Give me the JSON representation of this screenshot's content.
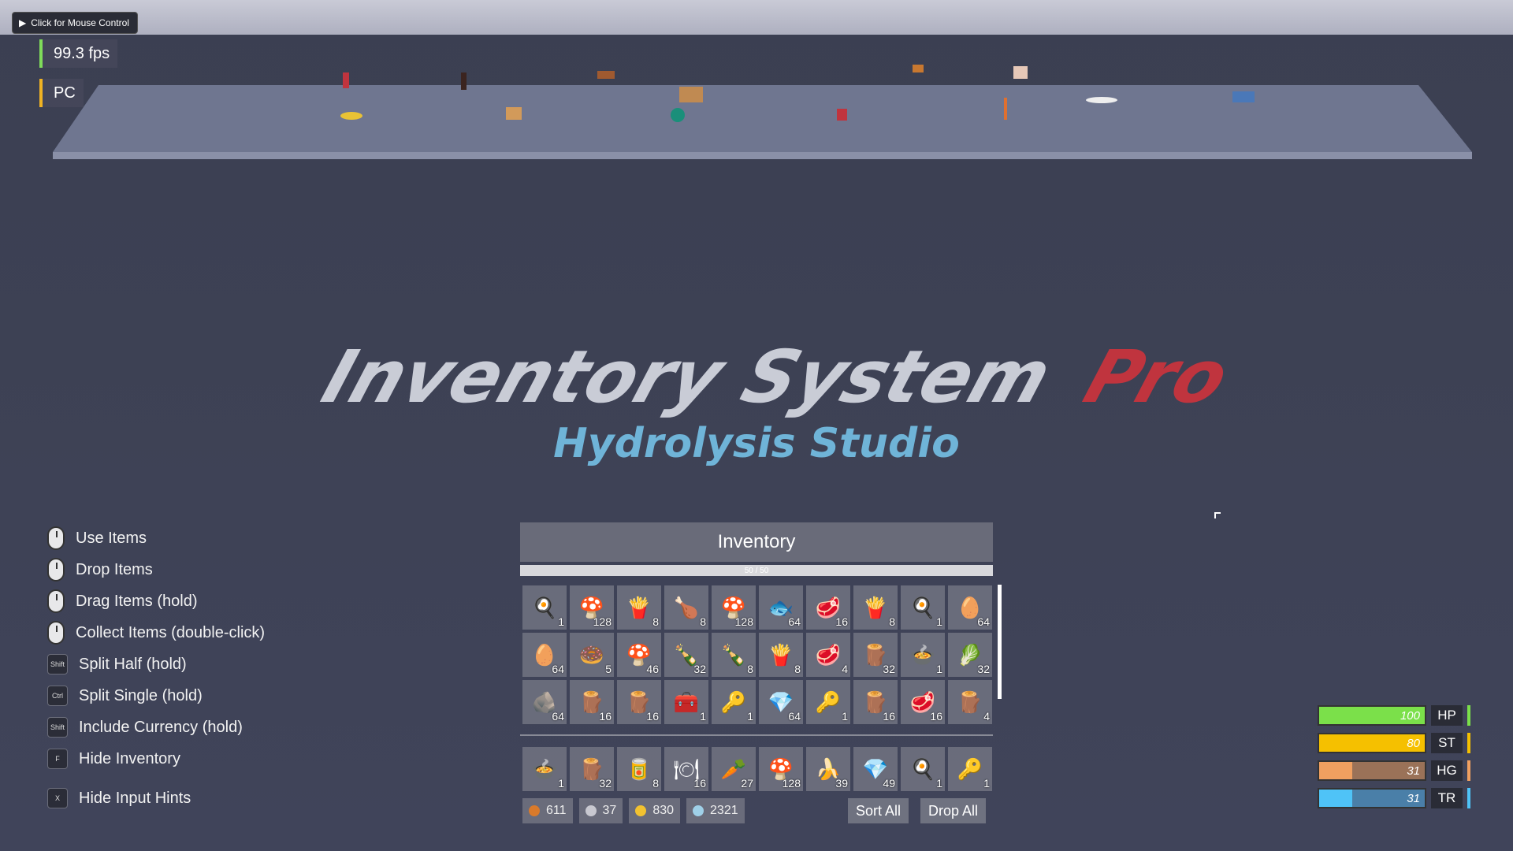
{
  "mouse_control": {
    "label": "Click for Mouse Control"
  },
  "fps": {
    "label": "99.3 fps",
    "color": "#7fdc5a"
  },
  "platform_label": {
    "label": "PC",
    "color": "#f0b323"
  },
  "title": {
    "main": "Inventory System",
    "accent": "Pro",
    "subtitle": "Hydrolysis Studio"
  },
  "colors": {
    "title_main": "#c9ccd6",
    "title_accent": "#c0343e",
    "subtitle": "#6fb4d8"
  },
  "hints": [
    {
      "key": "mouse-left",
      "label": "Use Items"
    },
    {
      "key": "mouse-right",
      "label": "Drop Items"
    },
    {
      "key": "mouse-left",
      "label": "Drag Items (hold)"
    },
    {
      "key": "mouse-left",
      "label": "Collect Items (double-click)"
    },
    {
      "key": "Shift",
      "label": "Split Half (hold)"
    },
    {
      "key": "Ctrl",
      "label": "Split Single (hold)"
    },
    {
      "key": "Shift",
      "label": "Include Currency (hold)"
    },
    {
      "key": "F",
      "label": "Hide Inventory"
    },
    {
      "key": "X",
      "label": "Hide Input Hints"
    }
  ],
  "inventory": {
    "title": "Inventory",
    "capacity": "50 / 50",
    "slots": [
      {
        "icon": "pan-icon",
        "glyph": "🍳",
        "count": "1"
      },
      {
        "icon": "mushroom-icon",
        "glyph": "🍄",
        "count": "128"
      },
      {
        "icon": "fries-icon",
        "glyph": "🍟",
        "count": "8"
      },
      {
        "icon": "meat-leg-icon",
        "glyph": "🍗",
        "count": "8"
      },
      {
        "icon": "mushroom-icon",
        "glyph": "🍄",
        "count": "128"
      },
      {
        "icon": "fish-icon",
        "glyph": "🐟",
        "count": "64"
      },
      {
        "icon": "steak-icon",
        "glyph": "🥩",
        "count": "16"
      },
      {
        "icon": "fries-icon",
        "glyph": "🍟",
        "count": "8"
      },
      {
        "icon": "pan-icon",
        "glyph": "🍳",
        "count": "1"
      },
      {
        "icon": "egg-icon",
        "glyph": "🥚",
        "count": "64"
      },
      {
        "icon": "egg-icon",
        "glyph": "🥚",
        "count": "64"
      },
      {
        "icon": "donut-icon",
        "glyph": "🍩",
        "count": "5"
      },
      {
        "icon": "mushroom-icon",
        "glyph": "🍄",
        "count": "46"
      },
      {
        "icon": "bottle-icon",
        "glyph": "🍾",
        "count": "32"
      },
      {
        "icon": "bottle-icon",
        "glyph": "🍾",
        "count": "8"
      },
      {
        "icon": "fries-icon",
        "glyph": "🍟",
        "count": "8"
      },
      {
        "icon": "steak-icon",
        "glyph": "🥩",
        "count": "4"
      },
      {
        "icon": "logs-icon",
        "glyph": "🪵",
        "count": "32"
      },
      {
        "icon": "pot-icon",
        "glyph": "🍲",
        "count": "1"
      },
      {
        "icon": "cabbage-icon",
        "glyph": "🥬",
        "count": "32"
      },
      {
        "icon": "stone-icon",
        "glyph": "🪨",
        "count": "64"
      },
      {
        "icon": "plank-icon",
        "glyph": "🪵",
        "count": "16"
      },
      {
        "icon": "plank-icon",
        "glyph": "🪵",
        "count": "16"
      },
      {
        "icon": "chest-icon",
        "glyph": "🧰",
        "count": "1"
      },
      {
        "icon": "key-icon",
        "glyph": "🔑",
        "count": "1"
      },
      {
        "icon": "ore-icon",
        "glyph": "💎",
        "count": "64"
      },
      {
        "icon": "key-icon",
        "glyph": "🔑",
        "count": "1"
      },
      {
        "icon": "plank-icon",
        "glyph": "🪵",
        "count": "16"
      },
      {
        "icon": "steak-icon",
        "glyph": "🥩",
        "count": "16"
      },
      {
        "icon": "plank-icon",
        "glyph": "🪵",
        "count": "4"
      }
    ],
    "hotbar": [
      {
        "icon": "pot-icon",
        "glyph": "🍲",
        "count": "1"
      },
      {
        "icon": "logs-icon",
        "glyph": "🪵",
        "count": "32"
      },
      {
        "icon": "can-icon",
        "glyph": "🥫",
        "count": "8"
      },
      {
        "icon": "plate-icon",
        "glyph": "🍽",
        "count": "16"
      },
      {
        "icon": "carrot-icon",
        "glyph": "🥕",
        "count": "27"
      },
      {
        "icon": "mushroom-icon",
        "glyph": "🍄",
        "count": "128"
      },
      {
        "icon": "banana-icon",
        "glyph": "🍌",
        "count": "39"
      },
      {
        "icon": "ore-icon",
        "glyph": "💎",
        "count": "49"
      },
      {
        "icon": "pan-icon",
        "glyph": "🍳",
        "count": "1"
      },
      {
        "icon": "key-icon",
        "glyph": "🔑",
        "count": "1"
      }
    ],
    "currency": [
      {
        "icon": "copper-coin-icon",
        "color": "#d97a2b",
        "value": "611"
      },
      {
        "icon": "silver-coin-icon",
        "color": "#c8c8d0",
        "value": "37"
      },
      {
        "icon": "gold-coin-icon",
        "color": "#f2c230",
        "value": "830"
      },
      {
        "icon": "gem-icon",
        "color": "#9fd0e8",
        "value": "2321"
      }
    ],
    "sort_label": "Sort All",
    "drop_label": "Drop All"
  },
  "vitals": [
    {
      "label": "HP",
      "value": "100",
      "level": 1.0,
      "color": "#7be04a",
      "track": "#7be04a"
    },
    {
      "label": "ST",
      "value": "80",
      "level": 1.0,
      "color": "#f5c000",
      "track": "#f5c000"
    },
    {
      "label": "HG",
      "value": "31",
      "level": 0.31,
      "color": "#f0a060",
      "track": "#9a7258"
    },
    {
      "label": "TR",
      "value": "31",
      "level": 0.31,
      "color": "#4fc3f7",
      "track": "#4a7fa8"
    }
  ]
}
